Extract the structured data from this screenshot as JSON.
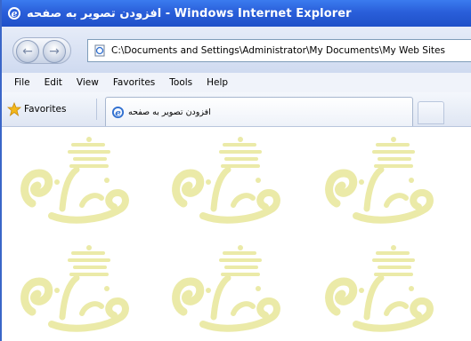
{
  "window": {
    "title": "افزودن تصویر به صفحه - Windows Internet Explorer"
  },
  "address": {
    "url": "C:\\Documents and Settings\\Administrator\\My Documents\\My Web Sites"
  },
  "menu": {
    "items": [
      "File",
      "Edit",
      "View",
      "Favorites",
      "Tools",
      "Help"
    ]
  },
  "favorites": {
    "label": "Favorites"
  },
  "tab": {
    "title": "افزودن تصویر به صفحه"
  },
  "content": {
    "tile_count": 6
  },
  "colors": {
    "titlebar": "#2a5fda",
    "logo": "#ebeaa8"
  },
  "icons": {
    "browser": "ie-icon",
    "back": "back-arrow-icon",
    "forward": "forward-arrow-icon",
    "page": "page-icon",
    "favorites": "star-icon",
    "logo": "toloo-logo"
  }
}
